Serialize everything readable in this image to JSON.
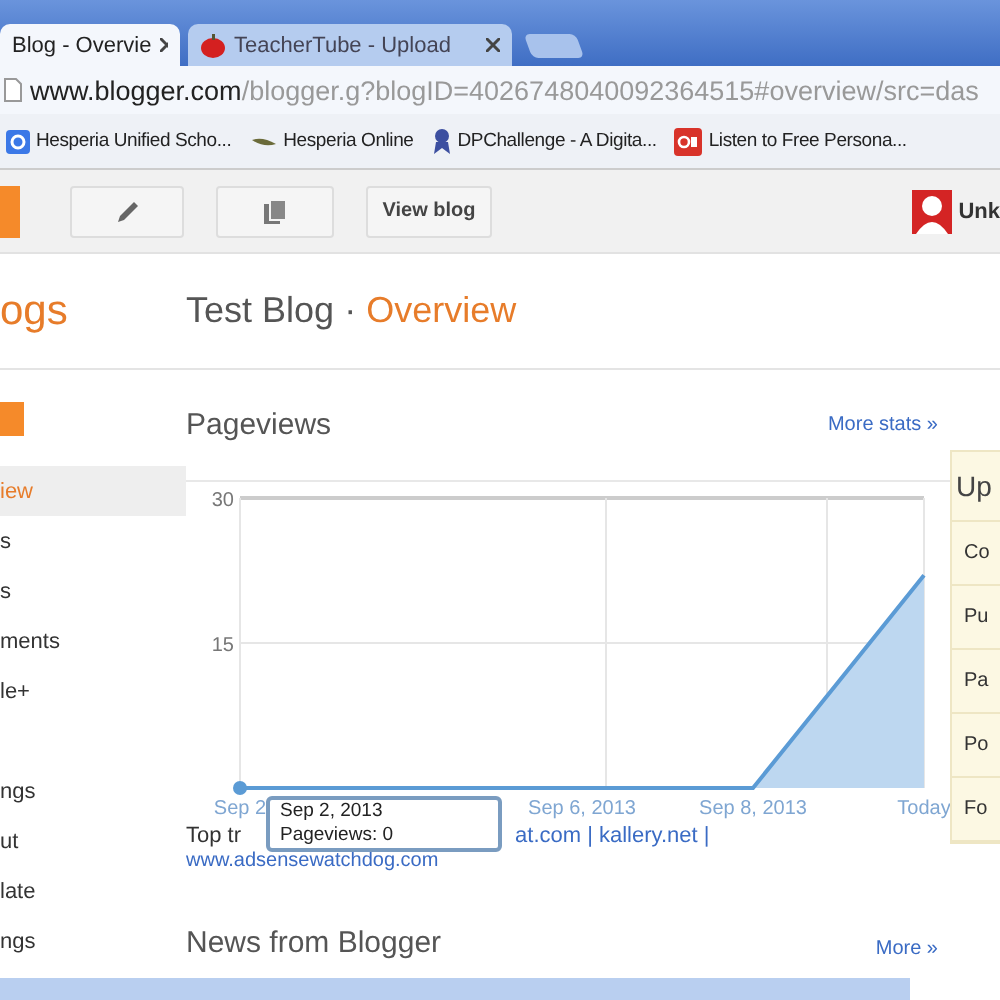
{
  "tabs": [
    {
      "title": "Blog - Overvie",
      "selected": true
    },
    {
      "title": "TeacherTube - Upload",
      "selected": false
    }
  ],
  "address": {
    "host": "www.blogger.com",
    "path": "/blogger.g?blogID=4026748040092364515#overview/src=das"
  },
  "bookmarks": [
    {
      "label": "Hesperia Unified Scho..."
    },
    {
      "label": "Hesperia Online"
    },
    {
      "label": "DPChallenge - A Digita..."
    },
    {
      "label": "Listen to Free Persona..."
    }
  ],
  "toolbar": [
    {
      "kind": "new"
    },
    {
      "kind": "edit"
    },
    {
      "kind": "pages"
    },
    {
      "kind": "view",
      "label": "View blog"
    }
  ],
  "account": {
    "name": "Unk"
  },
  "brand": "ogs",
  "blog_title": "Test Blog",
  "separator": "·",
  "page_title": "Overview",
  "sidebar": {
    "items": [
      {
        "label": "iew",
        "selected": true
      },
      {
        "label": "s",
        "selected": false
      },
      {
        "label": "s",
        "selected": false
      },
      {
        "label": "ments",
        "selected": false
      },
      {
        "label": "le+",
        "selected": false
      },
      {
        "label": "ngs",
        "selected": false
      },
      {
        "label": "ut",
        "selected": false
      },
      {
        "label": "late",
        "selected": false
      },
      {
        "label": "ngs",
        "selected": false
      }
    ]
  },
  "pageviews": {
    "title": "Pageviews",
    "more": "More stats »",
    "chart_data": {
      "type": "area",
      "categories": [
        "Sep 2",
        null,
        null,
        null,
        "Sep 6, 2013",
        null,
        "Sep 8, 2013",
        null,
        "Today"
      ],
      "series": [
        {
          "color": "#5b9bd5",
          "values": [
            0,
            0,
            0,
            0,
            0,
            0,
            0,
            11,
            22
          ]
        }
      ],
      "ylim": [
        0,
        30
      ],
      "yticks": [
        15,
        30
      ]
    },
    "tooltip": {
      "date": "Sep 2, 2013",
      "value": "Pageviews: 0"
    }
  },
  "traffic": {
    "lead": "Top tr",
    "links": "at.com | kallery.net |",
    "url": "www.adsensewatchdog.com"
  },
  "news": {
    "title": "News from Blogger",
    "more": "More »"
  },
  "side_panel": {
    "title": "Up",
    "items": [
      "Co",
      "Pu",
      "Pa",
      "Po",
      "Fo"
    ]
  }
}
